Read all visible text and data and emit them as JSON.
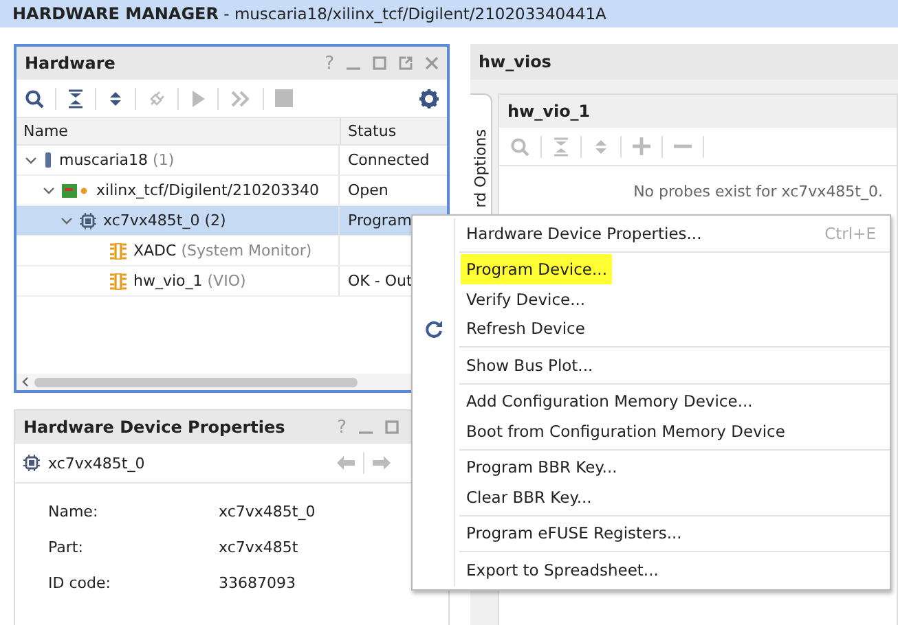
{
  "title": {
    "app": "HARDWARE MANAGER",
    "path": " - muscaria18/xilinx_tcf/Digilent/210203340441A"
  },
  "hardware": {
    "title": "Hardware",
    "help": "?",
    "columns": [
      "Name",
      "Status"
    ],
    "tree": [
      {
        "kind": "server",
        "name": "muscaria18",
        "note": "(1)",
        "status": "Connected",
        "expanded": true,
        "selected": false,
        "children": [
          {
            "kind": "target",
            "name": "xilinx_tcf/Digilent/210203340",
            "status": "Open",
            "expanded": true,
            "selected": false,
            "children": [
              {
                "kind": "device",
                "name": "xc7vx485t_0",
                "note": "(2)",
                "status": "Program",
                "expanded": true,
                "selected": true,
                "children": [
                  {
                    "kind": "core",
                    "name": "XADC",
                    "note": "(System Monitor)",
                    "selected": false
                  },
                  {
                    "kind": "core",
                    "name": "hw_vio_1",
                    "note": "(VIO)",
                    "status": "OK - Out",
                    "selected": false
                  }
                ]
              }
            ]
          }
        ]
      }
    ]
  },
  "vios": {
    "title": "hw_vios",
    "side_tab": "rd Options",
    "inner_title": "hw_vio_1",
    "message": "No probes exist for xc7vx485t_0."
  },
  "properties": {
    "title": "Hardware Device Properties",
    "help": "?",
    "object": "xc7vx485t_0",
    "rows": [
      {
        "label": "Name:",
        "value": "xc7vx485t_0"
      },
      {
        "label": "Part:",
        "value": "xc7vx485t"
      },
      {
        "label": "ID code:",
        "value": "33687093"
      }
    ]
  },
  "context_menu": {
    "groups": [
      [
        {
          "kind": "plain",
          "label": "Hardware Device Properties...",
          "shortcut": "Ctrl+E",
          "highlighted": false
        }
      ],
      [
        {
          "kind": "plain",
          "label": "Program Device...",
          "highlighted": true
        },
        {
          "kind": "plain",
          "label": "Verify Device...",
          "highlighted": false
        },
        {
          "kind": "refresh",
          "label": "Refresh Device",
          "highlighted": false
        }
      ],
      [
        {
          "kind": "plain",
          "label": "Show Bus Plot...",
          "highlighted": false
        }
      ],
      [
        {
          "kind": "plain",
          "label": "Add Configuration Memory Device...",
          "highlighted": false
        },
        {
          "kind": "plain",
          "label": "Boot from Configuration Memory Device",
          "highlighted": false
        }
      ],
      [
        {
          "kind": "plain",
          "label": "Program BBR Key...",
          "highlighted": false
        },
        {
          "kind": "plain",
          "label": "Clear BBR Key...",
          "highlighted": false
        }
      ],
      [
        {
          "kind": "plain",
          "label": "Program eFUSE Registers...",
          "highlighted": false
        }
      ],
      [
        {
          "kind": "plain",
          "label": "Export to Spreadsheet...",
          "highlighted": false
        }
      ]
    ]
  }
}
